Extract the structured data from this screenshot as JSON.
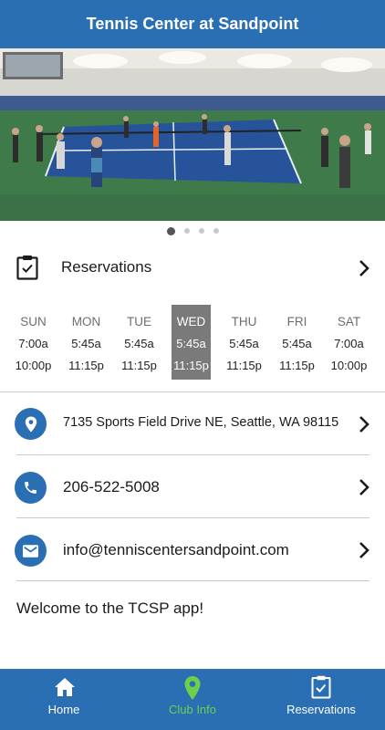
{
  "header": {
    "title": "Tennis Center at Sandpoint"
  },
  "carousel": {
    "slide_count": 4,
    "active_index": 0
  },
  "reservations": {
    "label": "Reservations"
  },
  "hours": [
    {
      "day": "SUN",
      "open": "7:00a",
      "close": "10:00p",
      "today": false
    },
    {
      "day": "MON",
      "open": "5:45a",
      "close": "11:15p",
      "today": false
    },
    {
      "day": "TUE",
      "open": "5:45a",
      "close": "11:15p",
      "today": false
    },
    {
      "day": "WED",
      "open": "5:45a",
      "close": "11:15p",
      "today": true
    },
    {
      "day": "THU",
      "open": "5:45a",
      "close": "11:15p",
      "today": false
    },
    {
      "day": "FRI",
      "open": "5:45a",
      "close": "11:15p",
      "today": false
    },
    {
      "day": "SAT",
      "open": "7:00a",
      "close": "10:00p",
      "today": false
    }
  ],
  "contact": {
    "address": "7135 Sports Field Drive NE, Seattle, WA 98115",
    "phone": "206-522-5008",
    "email": "info@tenniscentersandpoint.com"
  },
  "welcome": "Welcome to the TCSP app!",
  "tabbar": {
    "items": [
      {
        "label": "Home",
        "icon": "home-icon",
        "active": false
      },
      {
        "label": "Club Info",
        "icon": "map-pin-icon",
        "active": true
      },
      {
        "label": "Reservations",
        "icon": "clipboard-check-icon",
        "active": false
      }
    ]
  },
  "colors": {
    "brand": "#2a6eb3",
    "active_tab": "#6fcf4a",
    "today_bg": "#7a7a7a"
  }
}
